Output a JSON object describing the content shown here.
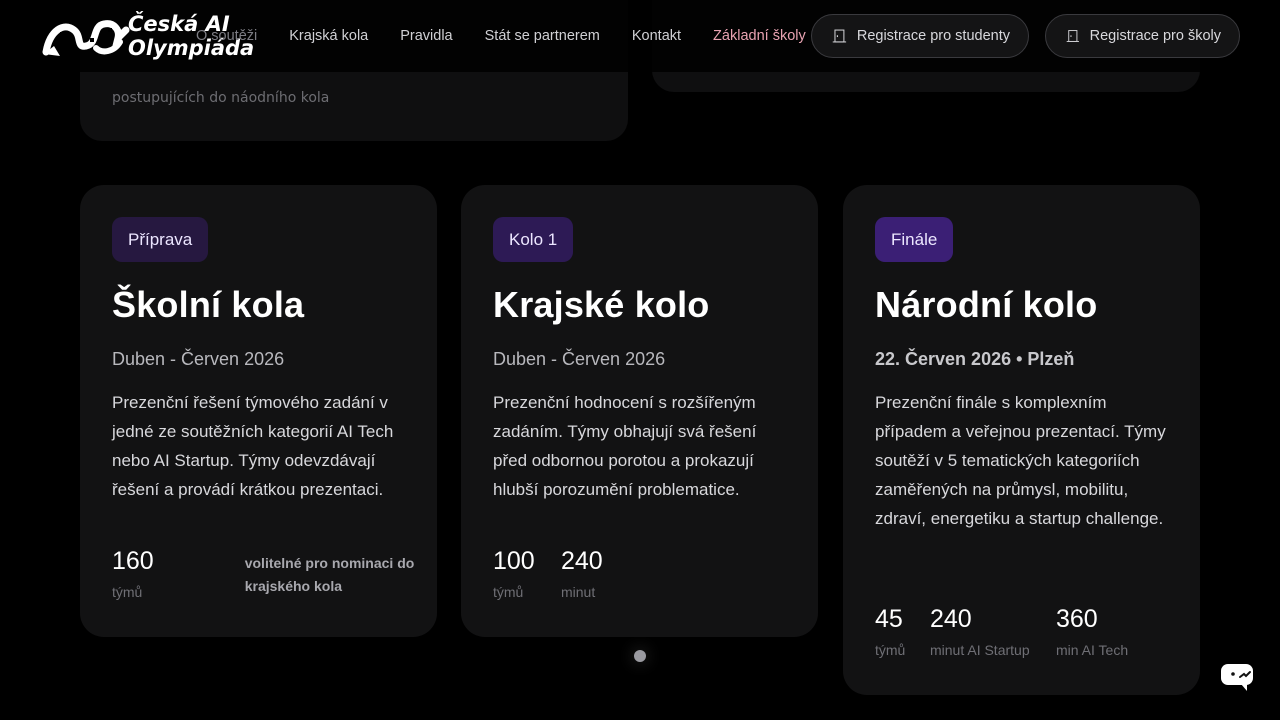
{
  "top_cards": {
    "left_caption": "postupujících do náodního kola"
  },
  "header": {
    "logo_line1": "Česká AI",
    "logo_line2": "Olympiáda",
    "nav": [
      {
        "label": "O soutěži"
      },
      {
        "label": "Krajská kola"
      },
      {
        "label": "Pravidla"
      },
      {
        "label": "Stát se partnerem"
      },
      {
        "label": "Kontakt"
      },
      {
        "label": "Základní školy"
      }
    ],
    "register_students": "Registrace pro studenty",
    "register_schools": "Registrace pro školy"
  },
  "cards": [
    {
      "badge": "Příprava",
      "title": "Školní kola",
      "date": "Duben - Červen 2026",
      "description": "Prezenční řešení týmového zadání v jedné ze soutěžních kategorií AI Tech nebo AI Startup. Týmy odevzdávají řešení a provádí krátkou prezentaci.",
      "stats": [
        {
          "value": "160",
          "label": "týmů"
        }
      ],
      "note": "volitelné pro nominaci do krajského kola"
    },
    {
      "badge": "Kolo 1",
      "title": "Krajské kolo",
      "date": "Duben - Červen 2026",
      "description": "Prezenční hodnocení s rozšířeným zadáním. Týmy obhajují svá řešení před odbornou porotou a prokazují hlubší porozumění problematice.",
      "stats": [
        {
          "value": "100",
          "label": "týmů"
        },
        {
          "value": "240",
          "label": "minut"
        }
      ]
    },
    {
      "badge": "Finále",
      "title": "Národní kolo",
      "date": "22. Červen 2026 • Plzeň",
      "description": "Prezenční finále s komplexním případem a veřejnou prezentací. Týmy soutěží v 5 tematických kategoriích zaměřených na průmysl, mobilitu, zdraví, energetiku a startup challenge.",
      "stats": [
        {
          "value": "45",
          "label": "týmů"
        },
        {
          "value": "240",
          "label": "minut AI Startup"
        },
        {
          "value": "360",
          "label": "min AI Tech"
        }
      ]
    }
  ],
  "colors": {
    "accent_link": "#e9a3b2",
    "badge_purple": "#3b1f75",
    "card_bg": "#121213"
  },
  "icons": {
    "register": "door-icon",
    "chat": "chat-bubble-icon"
  }
}
